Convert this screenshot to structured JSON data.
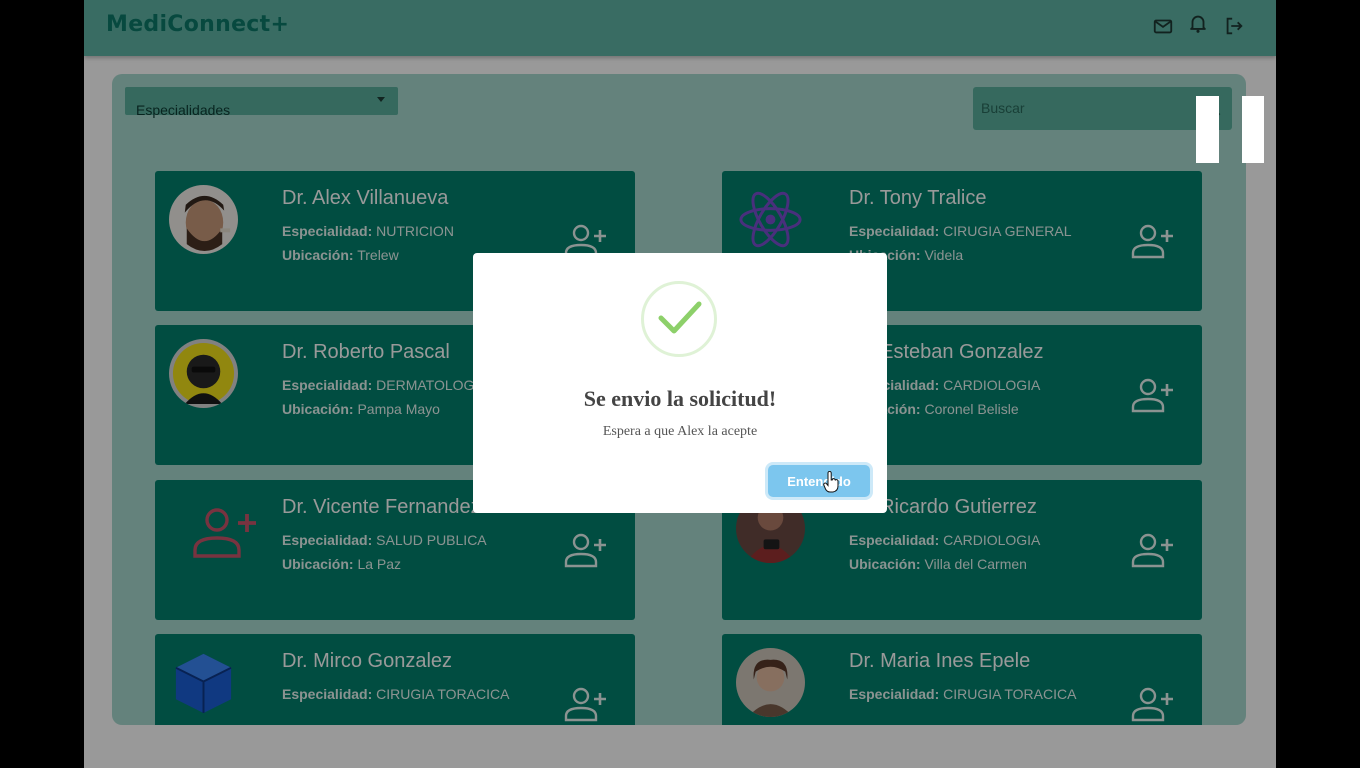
{
  "app": {
    "logo": "MediConnect+"
  },
  "filters": {
    "specialty_select": "Especialidades",
    "search_placeholder": "Buscar"
  },
  "labels": {
    "specialty": "Especialidad:",
    "location": "Ubicación:"
  },
  "doctors": [
    {
      "name": "Dr. Alex Villanueva",
      "specialty": "NUTRICION",
      "location": "Trelew",
      "avatar_icon": "man-photo-avatar"
    },
    {
      "name": "Dr. Tony Tralice",
      "specialty": "CIRUGIA GENERAL",
      "location": "Videla",
      "avatar_icon": "react-logo-avatar"
    },
    {
      "name": "Dr. Roberto Pascal",
      "specialty": "DERMATOLOGIA",
      "location": "Pampa Mayo",
      "avatar_icon": "cartoon-man-avatar"
    },
    {
      "name": "Dr. Esteban Gonzalez",
      "specialty": "CARDIOLOGIA",
      "location": "Coronel Belisle",
      "avatar_icon": "none"
    },
    {
      "name": "Dr. Vicente Fernandez",
      "specialty": "SALUD PUBLICA",
      "location": "La Paz",
      "avatar_icon": "person-add-placeholder-icon"
    },
    {
      "name": "Dr. Ricardo Gutierrez",
      "specialty": "CARDIOLOGIA",
      "location": "Villa del Carmen",
      "avatar_icon": "person-photo-avatar"
    },
    {
      "name": "Dr. Mirco Gonzalez",
      "specialty": "CIRUGIA TORACICA",
      "location": "",
      "avatar_icon": "cube-logo-avatar"
    },
    {
      "name": "Dr. Maria Ines Epele",
      "specialty": "CIRUGIA TORACICA",
      "location": "",
      "avatar_icon": "woman-photo-avatar"
    }
  ],
  "modal": {
    "title": "Se envio la solicitud!",
    "message": "Espera a que Alex la acepte",
    "button": "Entendido",
    "icon": "success-check-icon"
  },
  "colors": {
    "brand": "#0d7a6a",
    "topbar": "#5fb5a6",
    "card": "#03806d",
    "confirm_button": "#7cc6ee"
  }
}
